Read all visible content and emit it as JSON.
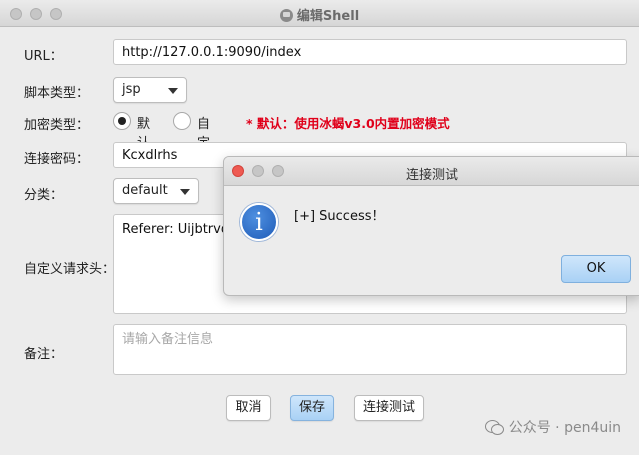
{
  "window": {
    "title": "编辑Shell",
    "title_icon": "shell-icon"
  },
  "form": {
    "url_label": "URL：",
    "url_value": "http://127.0.0.1:9090/index",
    "script_type_label": "脚本类型：",
    "script_type_value": "jsp",
    "encrypt_label": "加密类型：",
    "encrypt_options": [
      "默认",
      "自定义"
    ],
    "encrypt_selected": "默认",
    "encrypt_note": "* 默认：使用冰蝎v3.0内置加密模式",
    "password_label": "连接密码：",
    "password_value": "Kcxdlrhs",
    "category_label": "分类：",
    "category_value": "default",
    "headers_label": "自定义请求头：",
    "headers_value": "Referer: Uijbtrvqk",
    "remark_label": "备注：",
    "remark_placeholder": "请输入备注信息"
  },
  "buttons": {
    "cancel": "取消",
    "save": "保存",
    "test": "连接测试"
  },
  "dialog": {
    "title": "连接测试",
    "message": "[+] Success！",
    "ok": "OK",
    "icon": "info-icon"
  },
  "watermark": "公众号 · pen4uin",
  "colors": {
    "note_red": "#e0001a",
    "primary_button": "#a9d1f5"
  }
}
